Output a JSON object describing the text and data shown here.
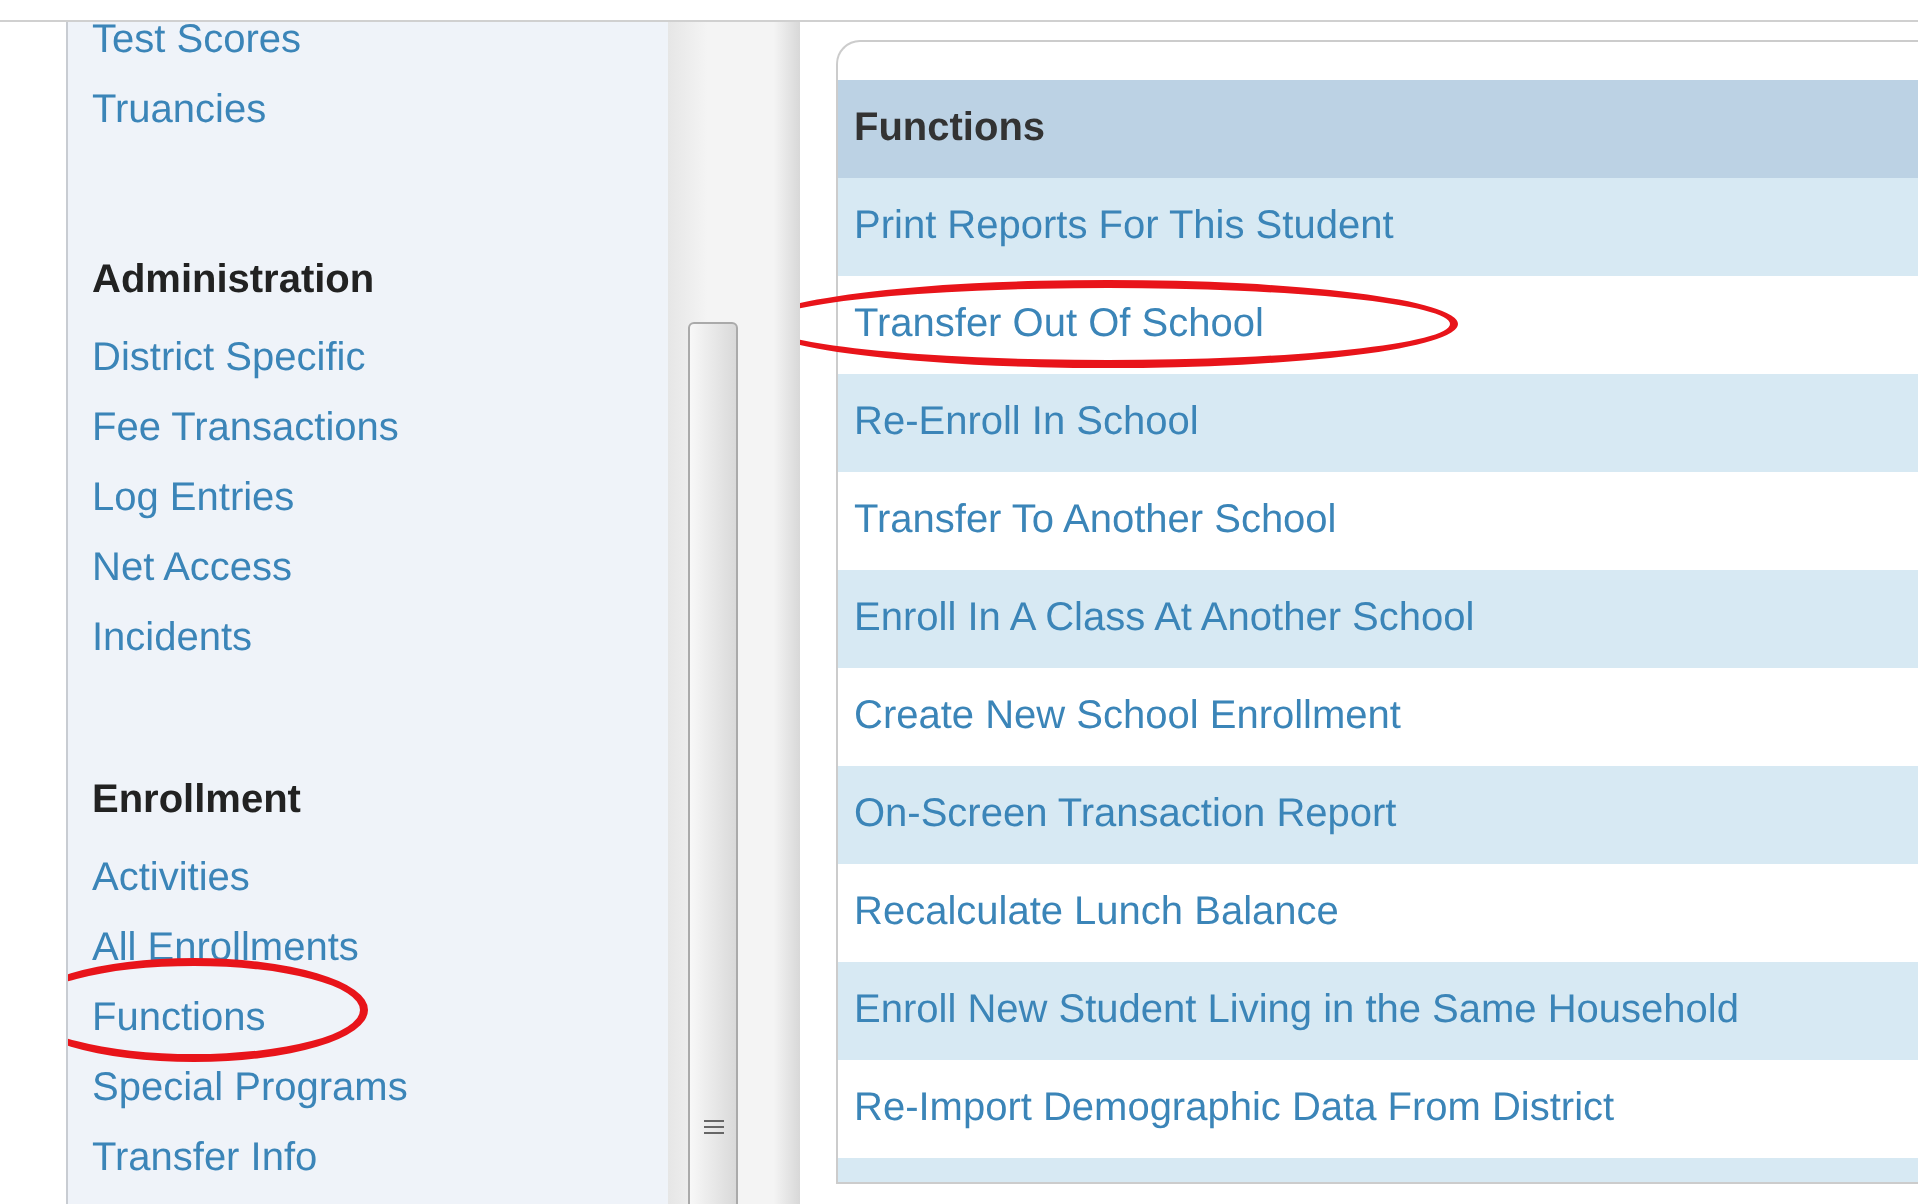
{
  "sidebar": {
    "sections": [
      {
        "items": [
          {
            "label": "Test Scores",
            "circled": false
          },
          {
            "label": "Truancies",
            "circled": false
          }
        ]
      },
      {
        "heading": "Administration",
        "items": [
          {
            "label": "District Specific",
            "circled": false
          },
          {
            "label": "Fee Transactions",
            "circled": false
          },
          {
            "label": "Log Entries",
            "circled": false
          },
          {
            "label": "Net Access",
            "circled": false
          },
          {
            "label": "Incidents",
            "circled": false
          }
        ]
      },
      {
        "heading": "Enrollment",
        "items": [
          {
            "label": "Activities",
            "circled": false
          },
          {
            "label": "All Enrollments",
            "circled": false
          },
          {
            "label": "Functions",
            "circled": true
          },
          {
            "label": "Special Programs",
            "circled": false
          },
          {
            "label": "Transfer Info",
            "circled": false
          }
        ]
      }
    ]
  },
  "functions_table": {
    "heading": "Functions",
    "rows": [
      {
        "label": "Print Reports For This Student",
        "circled": false
      },
      {
        "label": "Transfer Out Of School",
        "circled": true
      },
      {
        "label": "Re-Enroll In School",
        "circled": false
      },
      {
        "label": "Transfer To Another School",
        "circled": false
      },
      {
        "label": "Enroll In A Class At Another School",
        "circled": false
      },
      {
        "label": "Create New School Enrollment",
        "circled": false
      },
      {
        "label": "On-Screen Transaction Report",
        "circled": false
      },
      {
        "label": "Recalculate Lunch Balance",
        "circled": false
      },
      {
        "label": "Enroll New Student Living in the Same Household",
        "circled": false
      },
      {
        "label": "Re-Import Demographic Data From District",
        "circled": false
      }
    ]
  }
}
